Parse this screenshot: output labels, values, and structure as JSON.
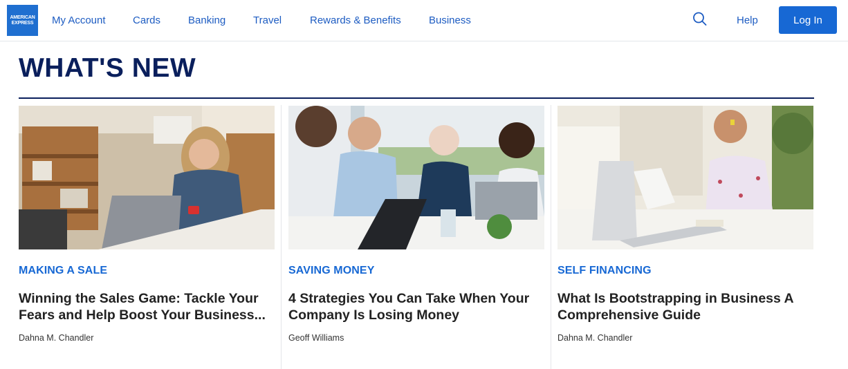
{
  "brand": {
    "logo_lines": [
      "AMERICAN",
      "EXPRESS"
    ],
    "color": "#1f6fd0"
  },
  "nav": {
    "items": [
      "My Account",
      "Cards",
      "Banking",
      "Travel",
      "Rewards & Benefits",
      "Business"
    ],
    "search_icon": "search-icon",
    "help_label": "Help",
    "login_label": "Log In"
  },
  "section": {
    "title": "WHAT'S NEW"
  },
  "articles": [
    {
      "category": "MAKING A SALE",
      "title": "Winning the Sales Game: Tackle Your Fears and Help Boost Your Business...",
      "author": "Dahna M. Chandler"
    },
    {
      "category": "SAVING MONEY",
      "title": "4 Strategies You Can Take When Your Company Is Losing Money",
      "author": "Geoff Williams"
    },
    {
      "category": "SELF FINANCING",
      "title": "What Is Bootstrapping in Business A Comprehensive Guide",
      "author": "Dahna M. Chandler"
    }
  ],
  "colors": {
    "link_blue": "#1d5cc2",
    "button_blue": "#1768d4",
    "heading_navy": "#0a1f5c"
  }
}
